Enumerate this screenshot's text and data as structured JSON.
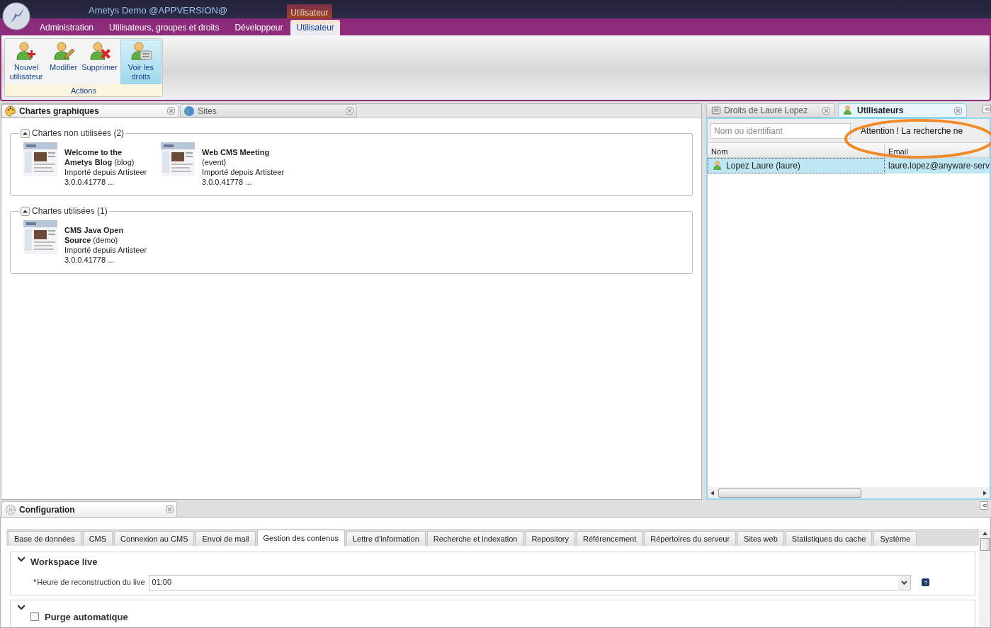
{
  "app": {
    "title": "Ametys Demo @APPVERSION@",
    "context_label": "Utilisateur"
  },
  "ribbon_tabs": [
    {
      "label": "Administration",
      "selected": false
    },
    {
      "label": "Utilisateurs, groupes et droits",
      "selected": false
    },
    {
      "label": "Développeur",
      "selected": false
    },
    {
      "label": "Utilisateur",
      "selected": true
    }
  ],
  "ribbon_group": {
    "label": "Actions",
    "buttons": [
      {
        "label": "Nouvel utilisateur",
        "kind": "add",
        "selected": false
      },
      {
        "label": "Modifier",
        "kind": "edit",
        "selected": false
      },
      {
        "label": "Supprimer",
        "kind": "delete",
        "selected": false
      },
      {
        "label": "Voir les droits",
        "kind": "rights",
        "selected": true
      }
    ]
  },
  "left_tabs": [
    {
      "label": "Chartes graphiques",
      "kind": "palette",
      "selected": true
    },
    {
      "label": "Sites",
      "kind": "globe",
      "selected": false
    }
  ],
  "sections": [
    {
      "title": "Chartes non utilisées (2)",
      "expanded": true,
      "items": [
        {
          "name": "**Welcome to the Ametys Blog** (blog)",
          "source": "Importé depuis Artisteer",
          "version": "3.0.0.41778 ..."
        },
        {
          "name": "**Web CMS Meeting** (event)",
          "source": "Importé depuis Artisteer",
          "version": "3.0.0.41778 ..."
        }
      ]
    },
    {
      "title": "Chartes utilisées (1)",
      "expanded": true,
      "items": [
        {
          "name": "**CMS Java Open Source** (demo)",
          "source": "Importé depuis Artisteer",
          "version": "3.0.0.41778 ..."
        }
      ]
    }
  ],
  "right_tabs": [
    {
      "label": "Droits de Laure Lopez",
      "kind": "list",
      "selected": false
    },
    {
      "label": "Utilisateurs",
      "kind": "user",
      "selected": true
    }
  ],
  "users": {
    "search_placeholder": "Nom ou identifiant",
    "warning": "Attention ! La recherche ne",
    "columns": [
      "Nom",
      "Email"
    ],
    "rows": [
      {
        "name": "Lopez Laure (laure)",
        "email": "laure.lopez@anyware-serv",
        "selected": true
      }
    ]
  },
  "config": {
    "panel_title": "Configuration",
    "tabs": [
      {
        "label": "Base de données",
        "selected": false
      },
      {
        "label": "CMS",
        "selected": false
      },
      {
        "label": "Connexion au CMS",
        "selected": false
      },
      {
        "label": "Envoi de mail",
        "selected": false
      },
      {
        "label": "Gestion des contenus",
        "selected": true
      },
      {
        "label": "Lettre d'information",
        "selected": false
      },
      {
        "label": "Recherche et indexation",
        "selected": false
      },
      {
        "label": "Repository",
        "selected": false
      },
      {
        "label": "Référencement",
        "selected": false
      },
      {
        "label": "Répertoires du serveur",
        "selected": false
      },
      {
        "label": "Sites web",
        "selected": false
      },
      {
        "label": "Statistiques du cache",
        "selected": false
      },
      {
        "label": "Système",
        "selected": false
      }
    ],
    "sections": [
      {
        "kind": "plain",
        "title": "Workspace live",
        "expanded": true,
        "fields": [
          {
            "mark": "*",
            "label": "Heure de reconstruction du live",
            "value": "01:00"
          }
        ]
      },
      {
        "kind": "checkbox",
        "title": "Purge automatique",
        "expanded": true,
        "checked": false
      }
    ]
  }
}
